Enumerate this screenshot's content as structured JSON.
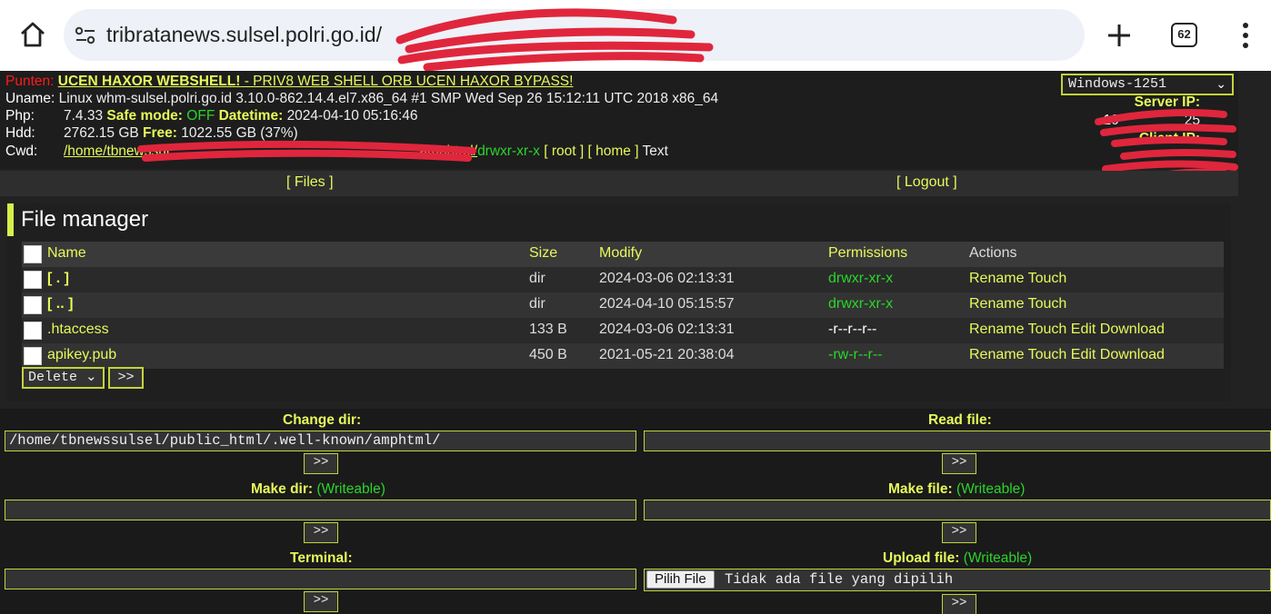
{
  "browser": {
    "url": "tribratanews.sulsel.polri.go.id/",
    "tab_count": "62"
  },
  "header": {
    "punten_label": "Punten:",
    "punten_link": "UCEN HAXOR WEBSHELL!",
    "punten_tail": " - PRIV8 WEB SHELL ORB UCEN HAXOR BYPASS!",
    "uname_label": "Uname:",
    "uname_value": "Linux whm-sulsel.polri.go.id 3.10.0-862.14.4.el7.x86_64 #1 SMP Wed Sep 26 15:12:11 UTC 2018 x86_64",
    "php_label": "Php:",
    "php_version": "7.4.33",
    "safe_mode_label": "Safe mode:",
    "safe_mode_value": "OFF",
    "datetime_label": "Datetime:",
    "datetime_value": "2024-04-10 05:16:46",
    "hdd_label": "Hdd:",
    "hdd_total": "2762.15 GB",
    "free_label": "Free:",
    "free_value": "1022.55 GB (37%)",
    "cwd_label": "Cwd:",
    "cwd_path": "/home/tbnewssul",
    "cwd_path_tail": "amphtml/",
    "cwd_perm": "drwxr-xr-x",
    "cwd_root": "[ root ]",
    "cwd_home": "[ home ]",
    "cwd_text": "Text",
    "encoding": "Windows-1251",
    "server_ip_label": "Server IP:",
    "server_ip_partial": "10",
    "server_ip_tail": "25",
    "client_ip_label": "Client IP:"
  },
  "menu": {
    "files": "[ Files ]",
    "logout": "[ Logout ]"
  },
  "file_manager": {
    "title": "File manager",
    "columns": [
      "Name",
      "Size",
      "Modify",
      "Permissions",
      "Actions"
    ],
    "rows": [
      {
        "name": "[ . ]",
        "size": "dir",
        "modify": "2024-03-06 02:13:31",
        "perm": "drwxr-xr-x",
        "actions": "Rename Touch"
      },
      {
        "name": "[ .. ]",
        "size": "dir",
        "modify": "2024-04-10 05:15:57",
        "perm": "drwxr-xr-x",
        "actions": "Rename Touch"
      },
      {
        "name": ".htaccess",
        "size": "133 B",
        "modify": "2024-03-06 02:13:31",
        "perm": "-r--r--r--",
        "actions": "Rename Touch Edit Download"
      },
      {
        "name": "apikey.pub",
        "size": "450 B",
        "modify": "2021-05-21 20:38:04",
        "perm": "-rw-r--r--",
        "actions": "Rename Touch Edit Download"
      }
    ],
    "bulk_action": "Delete",
    "go_label": ">>"
  },
  "tools": {
    "change_dir_title": "Change dir:",
    "change_dir_value": "/home/tbnewssulsel/public_html/.well-known/amphtml/",
    "read_file_title": "Read file:",
    "make_dir_title": "Make dir:",
    "make_file_title": "Make file:",
    "writeable_note": "(Writeable)",
    "terminal_title": "Terminal:",
    "upload_title": "Upload file:",
    "choose_file": "Pilih File",
    "no_file": "Tidak ada file yang dipilih",
    "go_label": ">>"
  },
  "colors": {
    "accent": "#e7f95a",
    "ok_green": "#2ad52a",
    "alert_red": "#ff1a1a",
    "redaction": "#e0263c"
  }
}
